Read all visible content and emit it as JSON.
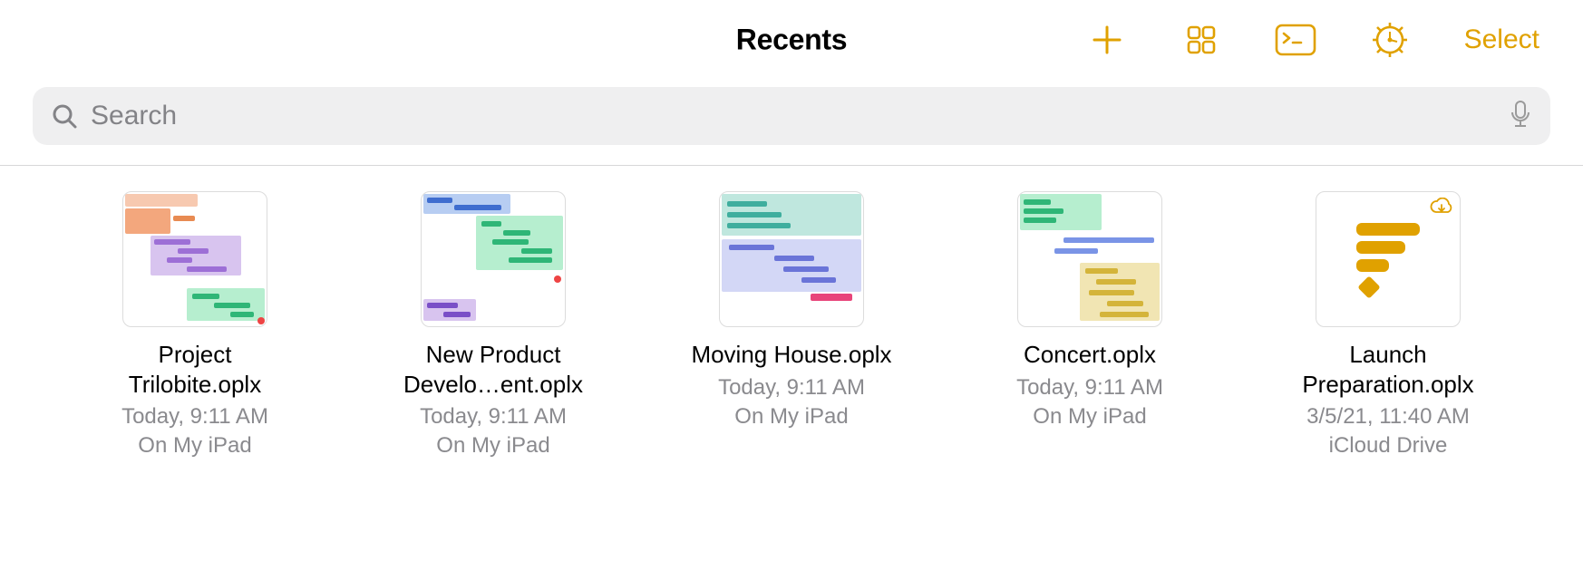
{
  "header": {
    "title": "Recents",
    "select_label": "Select"
  },
  "search": {
    "placeholder": "Search"
  },
  "accent_color": "#e0a100",
  "files": [
    {
      "name": "Project Trilobite.oplx",
      "date": "Today, 9:11 AM",
      "location": "On My iPad",
      "cloud": false
    },
    {
      "name": "New Product Develo…ent.oplx",
      "date": "Today, 9:11 AM",
      "location": "On My iPad",
      "cloud": false
    },
    {
      "name": "Moving House.oplx",
      "date": "Today, 9:11 AM",
      "location": "On My iPad",
      "cloud": false
    },
    {
      "name": "Concert.oplx",
      "date": "Today, 9:11 AM",
      "location": "On My iPad",
      "cloud": false
    },
    {
      "name": "Launch Preparation.oplx",
      "date": "3/5/21, 11:40 AM",
      "location": "iCloud Drive",
      "cloud": true
    }
  ]
}
